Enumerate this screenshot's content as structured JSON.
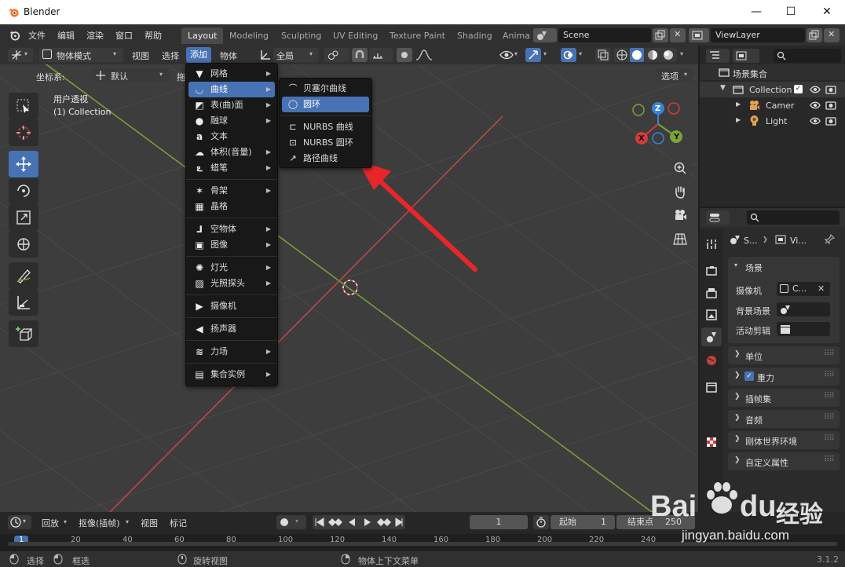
{
  "window": {
    "title": "Blender",
    "minimize": "—",
    "maximize": "☐",
    "close": "✕"
  },
  "topbar": {
    "menus": [
      "文件",
      "编辑",
      "渲染",
      "窗口",
      "帮助"
    ],
    "tabs": [
      "Layout",
      "Modeling",
      "Sculpting",
      "UV Editing",
      "Texture Paint",
      "Shading",
      "Anima"
    ],
    "scene": "Scene",
    "view_layer": "ViewLayer"
  },
  "viewport_header": {
    "mode": "物体模式",
    "menus": [
      "视图",
      "选择",
      "添加",
      "物体"
    ],
    "transform_orientation": "全局"
  },
  "tool_settings": {
    "coord_label": "坐标系:",
    "coord_value": "默认",
    "drag_label": "拖",
    "options": "选项"
  },
  "viewport": {
    "view_name": "用户透视",
    "collection": "(1) Collection"
  },
  "gizmo": {
    "z": "Z",
    "y": "Y",
    "x": "X"
  },
  "add_menu": [
    {
      "label": "网格",
      "sub": true,
      "icon": "mesh-icon"
    },
    {
      "label": "曲线",
      "sub": true,
      "icon": "curve-icon",
      "active": true
    },
    {
      "label": "表(曲)面",
      "sub": true,
      "icon": "surface-icon"
    },
    {
      "label": "融球",
      "sub": true,
      "icon": "metaball-icon"
    },
    {
      "label": "文本",
      "sub": false,
      "icon": "text-icon"
    },
    {
      "label": "体积(音量)",
      "sub": true,
      "icon": "volume-icon"
    },
    {
      "label": "蜡笔",
      "sub": true,
      "icon": "grease-pencil-icon"
    },
    {
      "label": "骨架",
      "sub": true,
      "icon": "armature-icon"
    },
    {
      "label": "晶格",
      "sub": false,
      "icon": "lattice-icon"
    },
    {
      "label": "空物体",
      "sub": true,
      "icon": "empty-icon"
    },
    {
      "label": "图像",
      "sub": true,
      "icon": "image-icon"
    },
    {
      "label": "灯光",
      "sub": true,
      "icon": "light-icon"
    },
    {
      "label": "光照探头",
      "sub": true,
      "icon": "light-probe-icon"
    },
    {
      "label": "摄像机",
      "sub": false,
      "icon": "camera-icon"
    },
    {
      "label": "扬声器",
      "sub": false,
      "icon": "speaker-icon"
    },
    {
      "label": "力场",
      "sub": true,
      "icon": "force-field-icon"
    },
    {
      "label": "集合实例",
      "sub": true,
      "icon": "collection-instance-icon"
    }
  ],
  "curve_menu": [
    {
      "label": "贝塞尔曲线",
      "icon": "bezier-icon"
    },
    {
      "label": "圆环",
      "icon": "circle-curve-icon",
      "active": true
    },
    {
      "label": "NURBS 曲线",
      "icon": "nurbs-curve-icon"
    },
    {
      "label": "NURBS 圆环",
      "icon": "nurbs-circle-icon"
    },
    {
      "label": "路径曲线",
      "icon": "path-icon"
    }
  ],
  "outliner": {
    "root": "场景集合",
    "collection": "Collection",
    "items": [
      "Camer",
      "Light"
    ]
  },
  "properties": {
    "tab_left": "S...",
    "tab_right": "Vi...",
    "scene_panel": "场景",
    "camera_label": "摄像机",
    "camera_value": "C...",
    "bg_label": "背景场景",
    "clip_label": "活动剪辑",
    "panels": [
      "单位",
      "重力",
      "插帧集",
      "音频",
      "刚体世界环境",
      "自定义属性"
    ]
  },
  "timeline": {
    "menus": [
      "回放",
      "抠像(插帧)",
      "视图",
      "标记"
    ],
    "current_frame": "1",
    "start_label": "起始",
    "start_value": "1",
    "end_label": "结束点",
    "end_value": "250",
    "ticks": [
      "1",
      "20",
      "40",
      "60",
      "80",
      "100",
      "120",
      "140",
      "160",
      "180",
      "200",
      "220",
      "240"
    ]
  },
  "statusbar": {
    "select": "选择",
    "box_select": "框选",
    "rotate_view": "旋转视图",
    "context_menu": "物体上下文菜单",
    "version": "3.1.2"
  },
  "watermark": {
    "brand": "Bai",
    "brand2": "du",
    "jingyan": "经验",
    "url": "jingyan.baidu.com"
  },
  "colors": {
    "accent": "#4772b3",
    "arrow": "#e8262a",
    "x_axis": "#d43c3c",
    "y_axis": "#7ba33a",
    "z_axis": "#3b82d6"
  }
}
